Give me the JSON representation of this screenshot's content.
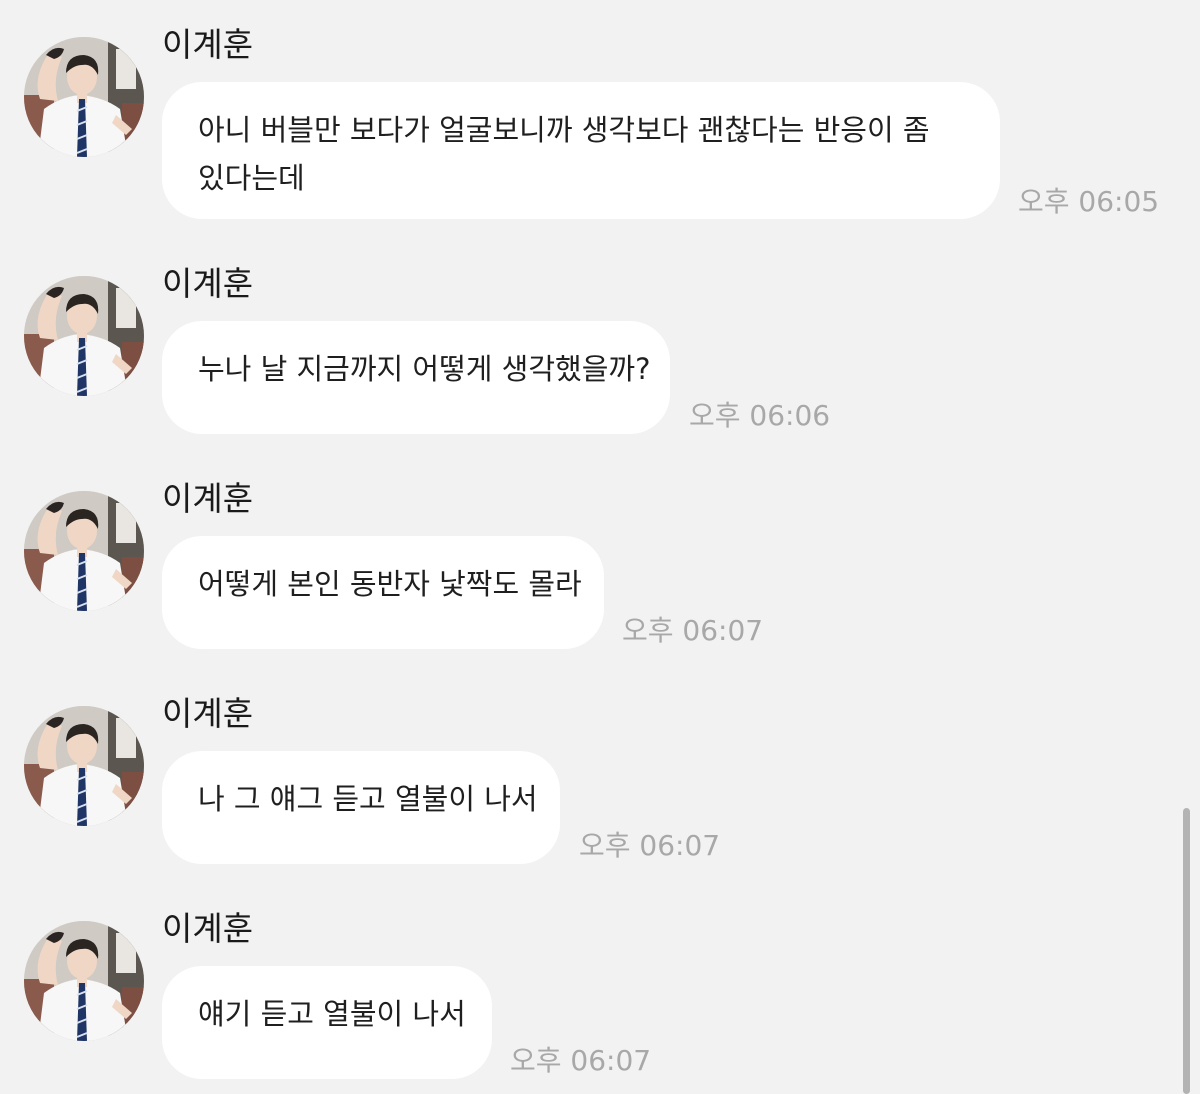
{
  "messages": [
    {
      "sender": "이계훈",
      "text": "아니 버블만 보다가 얼굴보니까 생각보다 괜찮다는 반응이 좀 있다는데",
      "time": "오후 06:05"
    },
    {
      "sender": "이계훈",
      "text": "누나 날 지금까지 어떻게 생각했을까?",
      "time": "오후 06:06"
    },
    {
      "sender": "이계훈",
      "text": "어떻게 본인 동반자 낯짝도 몰라",
      "time": "오후 06:07"
    },
    {
      "sender": "이계훈",
      "text": "나 그 얘그 듣고 열불이 나서",
      "time": "오후 06:07"
    },
    {
      "sender": "이계훈",
      "text": "얘기 듣고 열불이 나서",
      "time": "오후 06:07"
    }
  ],
  "avatar_icon": "profile-photo-icon",
  "colors": {
    "background": "#f2f2f2",
    "bubble": "#ffffff",
    "text": "#1f1f1f",
    "timestamp": "#a8a8a8"
  }
}
